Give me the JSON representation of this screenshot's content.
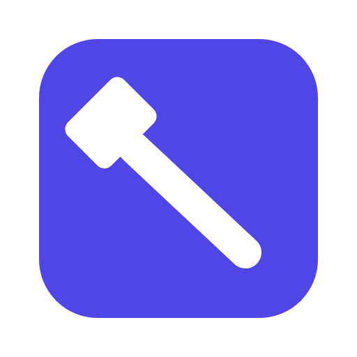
{
  "app_icon": {
    "icon": "gavel-icon",
    "background_color": "#4F46E5",
    "glyph_color": "#FFFFFF"
  }
}
